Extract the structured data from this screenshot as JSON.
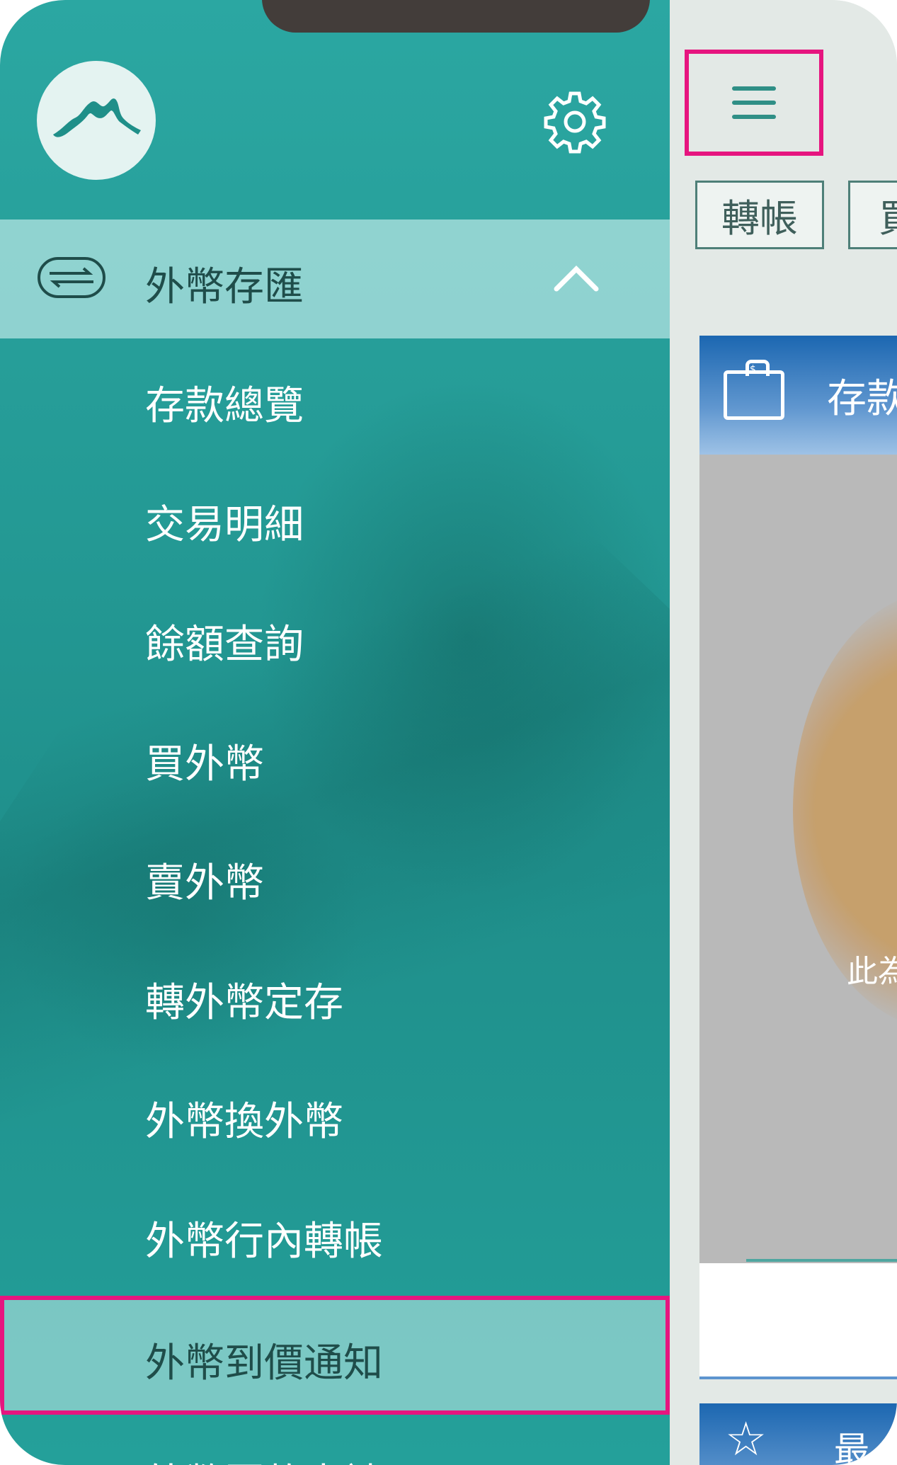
{
  "main": {
    "chips": [
      "轉帳",
      "買"
    ],
    "card_title": "存款",
    "pie_label": "此為",
    "bottom_card_text": "最"
  },
  "drawer": {
    "section": {
      "label": "外幣存匯",
      "expanded": true
    },
    "items": [
      {
        "label": "存款總覽"
      },
      {
        "label": "交易明細"
      },
      {
        "label": "餘額查詢"
      },
      {
        "label": "買外幣"
      },
      {
        "label": "賣外幣"
      },
      {
        "label": "轉外幣定存"
      },
      {
        "label": "外幣換外幣"
      },
      {
        "label": "外幣行內轉帳"
      },
      {
        "label": "外幣到價通知",
        "highlighted": true
      },
      {
        "label": "外幣匯款申請"
      }
    ]
  },
  "colors": {
    "drawer_teal": "#249a95",
    "highlight_border": "#e6157f",
    "header_blue": "#1c67b1"
  },
  "icons": [
    "app-logo-icon",
    "gear-icon",
    "exchange-icon",
    "chevron-up-icon",
    "hamburger-menu-icon",
    "money-bag-icon",
    "star-icon"
  ]
}
